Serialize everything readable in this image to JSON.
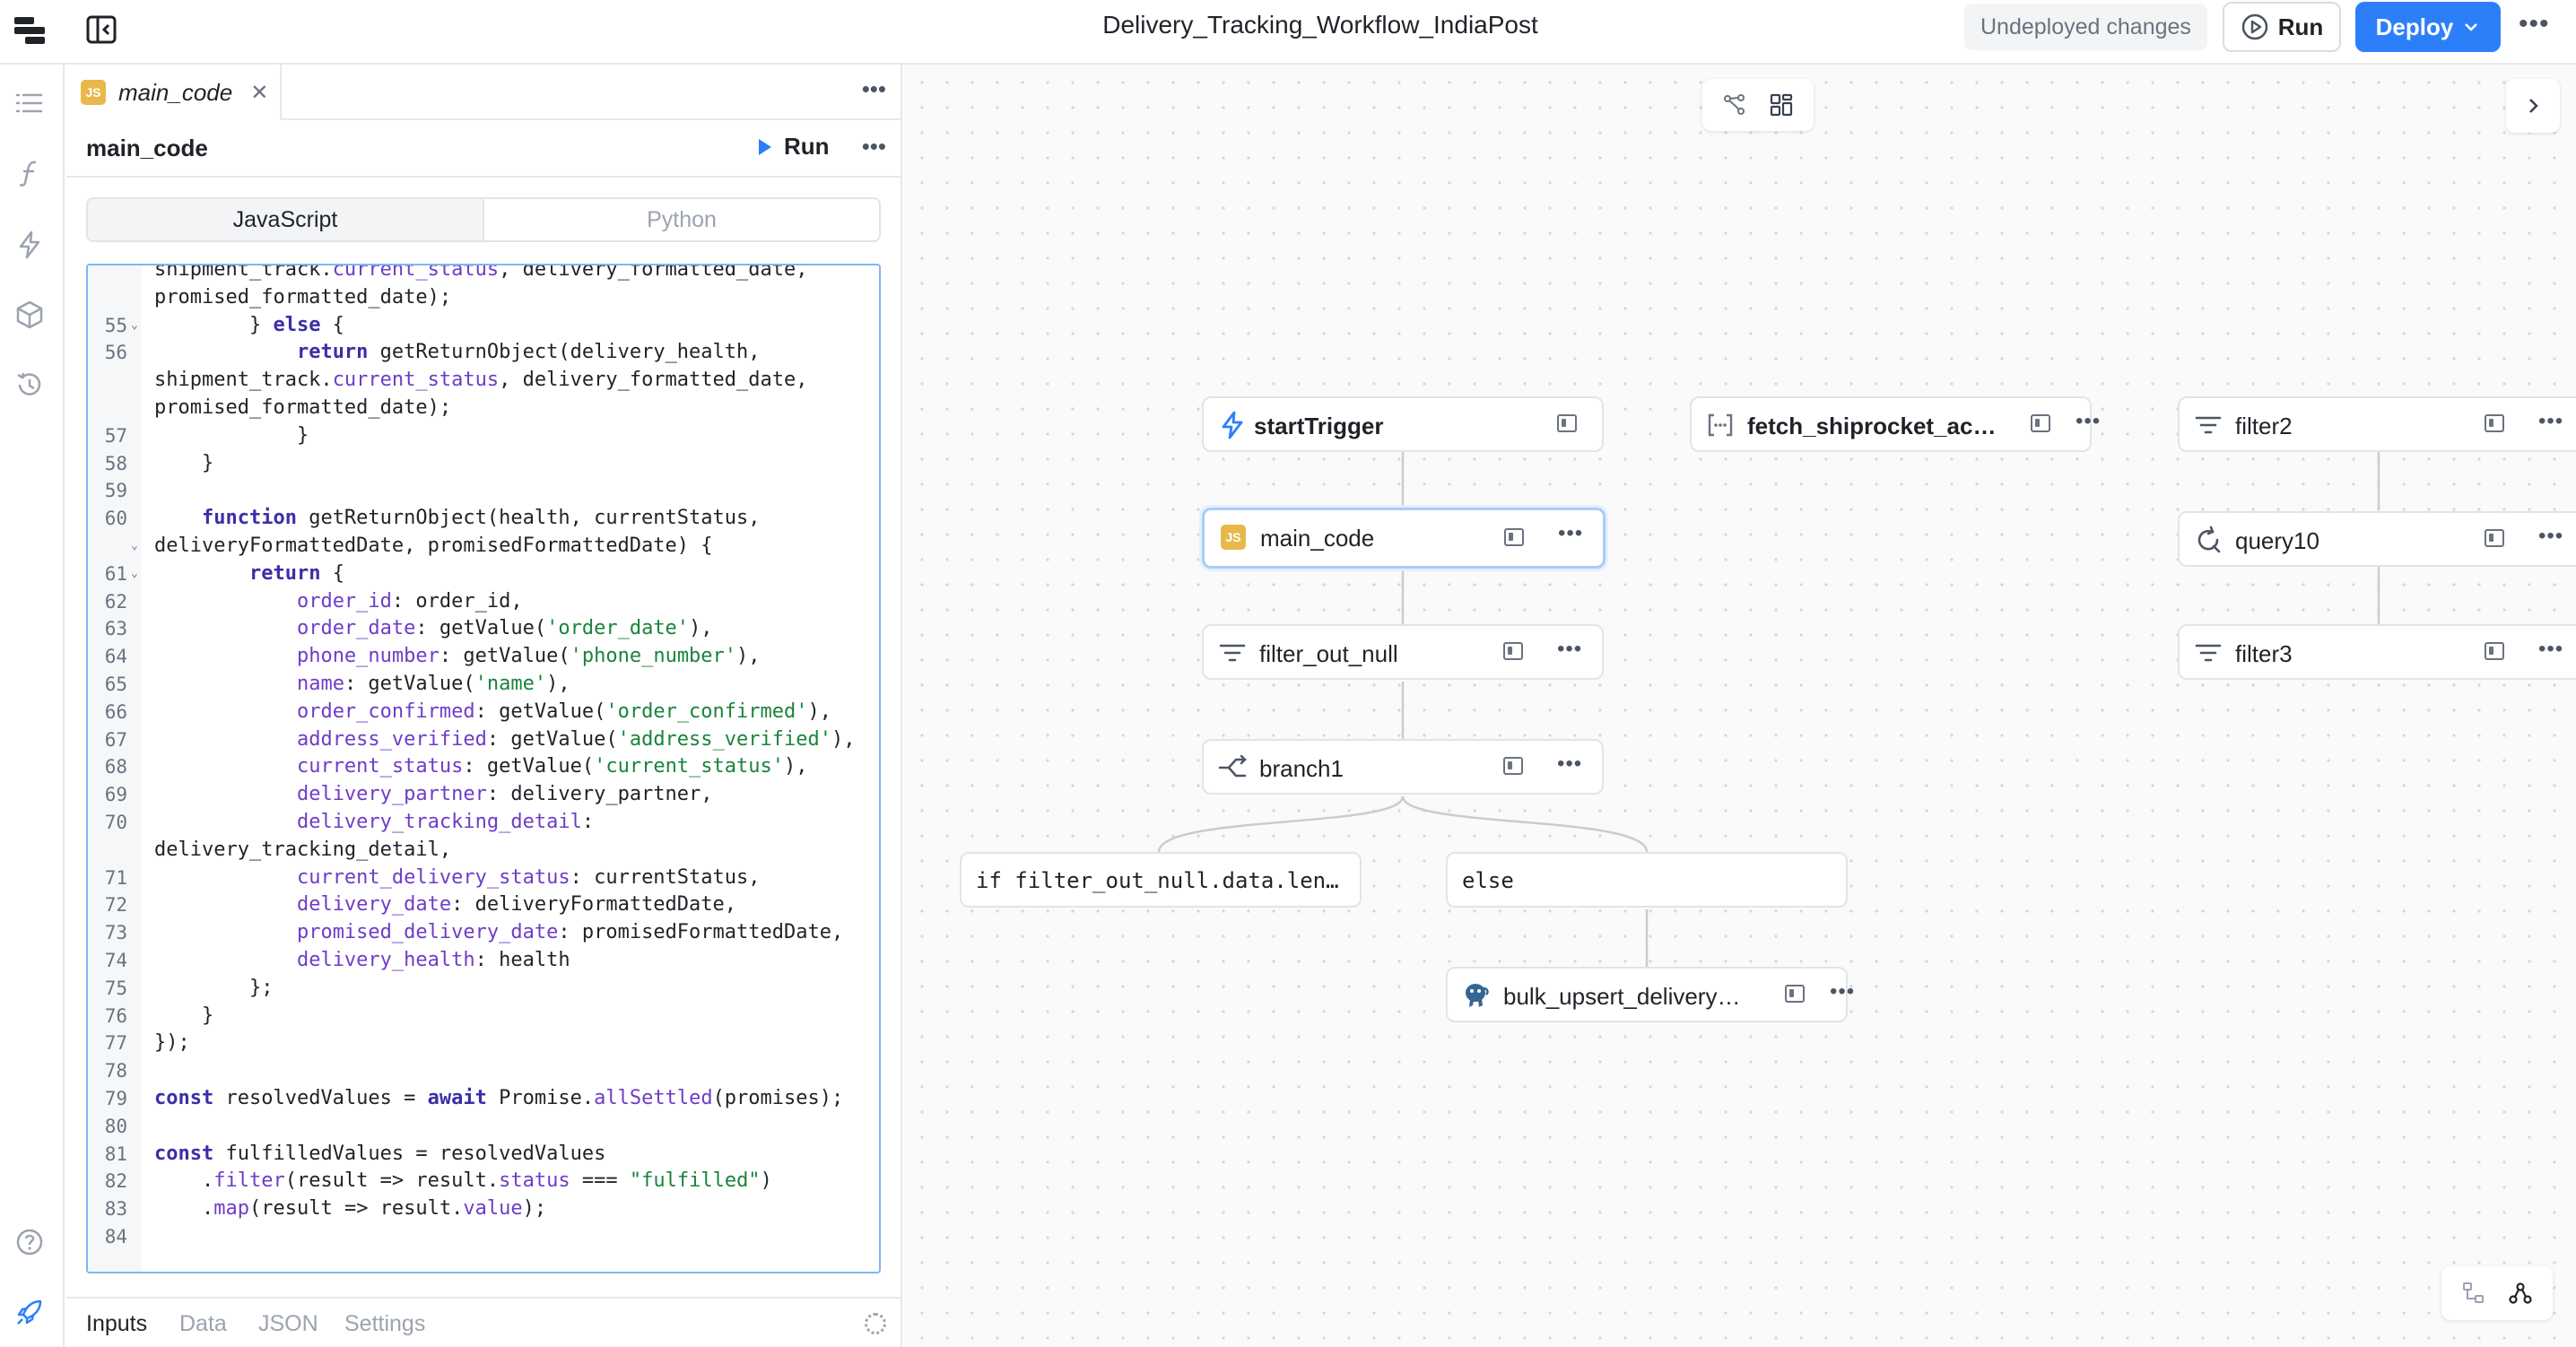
{
  "header": {
    "title": "Delivery_Tracking_Workflow_IndiaPost",
    "status_badge": "Undeployed changes",
    "run_label": "Run",
    "deploy_label": "Deploy"
  },
  "rail": {
    "icons": [
      "list-icon",
      "function-icon",
      "trigger-bolt-icon",
      "cube-icon",
      "history-icon",
      "help-icon",
      "rocket-icon"
    ]
  },
  "editor_panel": {
    "tab_label": "main_code",
    "tab_badge": "JS",
    "query_name": "main_code",
    "run_label": "Run",
    "languages": [
      "JavaScript",
      "Python"
    ],
    "active_language": "JavaScript",
    "bottom_tabs": [
      "Inputs",
      "Data",
      "JSON",
      "Settings"
    ],
    "active_bottom_tab": "Inputs",
    "code_lines": [
      {
        "n": "",
        "fold": "",
        "t": "shipment_track.current_status, delivery_formatted_date,"
      },
      {
        "n": "",
        "fold": "",
        "t": "promised_formatted_date);"
      },
      {
        "n": "55",
        "fold": "v",
        "t": "        } else {"
      },
      {
        "n": "56",
        "fold": "",
        "t": "            return getReturnObject(delivery_health,"
      },
      {
        "n": "",
        "fold": "",
        "t": "shipment_track.current_status, delivery_formatted_date,"
      },
      {
        "n": "",
        "fold": "",
        "t": "promised_formatted_date);"
      },
      {
        "n": "57",
        "fold": "",
        "t": "            }"
      },
      {
        "n": "58",
        "fold": "",
        "t": "    }"
      },
      {
        "n": "59",
        "fold": "",
        "t": ""
      },
      {
        "n": "60",
        "fold": "",
        "t": "    function getReturnObject(health, currentStatus,"
      },
      {
        "n": "",
        "fold": "v",
        "t": "deliveryFormattedDate, promisedFormattedDate) {"
      },
      {
        "n": "61",
        "fold": "v",
        "t": "        return {"
      },
      {
        "n": "62",
        "fold": "",
        "t": "            order_id: order_id,"
      },
      {
        "n": "63",
        "fold": "",
        "t": "            order_date: getValue('order_date'),"
      },
      {
        "n": "64",
        "fold": "",
        "t": "            phone_number: getValue('phone_number'),"
      },
      {
        "n": "65",
        "fold": "",
        "t": "            name: getValue('name'),"
      },
      {
        "n": "66",
        "fold": "",
        "t": "            order_confirmed: getValue('order_confirmed'),"
      },
      {
        "n": "67",
        "fold": "",
        "t": "            address_verified: getValue('address_verified'),"
      },
      {
        "n": "68",
        "fold": "",
        "t": "            current_status: getValue('current_status'),"
      },
      {
        "n": "69",
        "fold": "",
        "t": "            delivery_partner: delivery_partner,"
      },
      {
        "n": "70",
        "fold": "",
        "t": "            delivery_tracking_detail:"
      },
      {
        "n": "",
        "fold": "",
        "t": "delivery_tracking_detail,"
      },
      {
        "n": "71",
        "fold": "",
        "t": "            current_delivery_status: currentStatus,"
      },
      {
        "n": "72",
        "fold": "",
        "t": "            delivery_date: deliveryFormattedDate,"
      },
      {
        "n": "73",
        "fold": "",
        "t": "            promised_delivery_date: promisedFormattedDate,"
      },
      {
        "n": "74",
        "fold": "",
        "t": "            delivery_health: health"
      },
      {
        "n": "75",
        "fold": "",
        "t": "        };"
      },
      {
        "n": "76",
        "fold": "",
        "t": "    }"
      },
      {
        "n": "77",
        "fold": "",
        "t": "});"
      },
      {
        "n": "78",
        "fold": "",
        "t": ""
      },
      {
        "n": "79",
        "fold": "",
        "t": "const resolvedValues = await Promise.allSettled(promises);"
      },
      {
        "n": "80",
        "fold": "",
        "t": ""
      },
      {
        "n": "81",
        "fold": "",
        "t": "const fulfilledValues = resolvedValues"
      },
      {
        "n": "82",
        "fold": "",
        "t": "    .filter(result => result.status === \"fulfilled\")"
      },
      {
        "n": "83",
        "fold": "",
        "t": "    .map(result => result.value);"
      },
      {
        "n": "84",
        "fold": "",
        "t": ""
      }
    ]
  },
  "workflow": {
    "nodes": [
      {
        "id": "startTrigger",
        "label": "startTrigger",
        "icon": "bolt-icon"
      },
      {
        "id": "main_code",
        "label": "main_code",
        "icon": "js-icon",
        "selected": true
      },
      {
        "id": "filter_out_null",
        "label": "filter_out_null",
        "icon": "filter-icon"
      },
      {
        "id": "branch1",
        "label": "branch1",
        "icon": "branch-icon"
      },
      {
        "id": "fetch_shiprocket",
        "label": "fetch_shiprocket_acce...",
        "icon": "api-icon"
      },
      {
        "id": "filter2",
        "label": "filter2",
        "icon": "filter-icon"
      },
      {
        "id": "query10",
        "label": "query10",
        "icon": "loop-icon"
      },
      {
        "id": "filter3",
        "label": "filter3",
        "icon": "filter-icon"
      },
      {
        "id": "bulk_upsert",
        "label": "bulk_upsert_delivery_...",
        "icon": "postgres-icon"
      }
    ],
    "conditions": [
      {
        "id": "if_branch",
        "label": "if filter_out_null.data.len…"
      },
      {
        "id": "else_branch",
        "label": "else"
      }
    ]
  },
  "colors": {
    "accent": "#2d7ff9",
    "js_badge": "#e8b94a",
    "keyword": "#3b2fa6",
    "string": "#19843a",
    "property": "#6f3cc8"
  }
}
